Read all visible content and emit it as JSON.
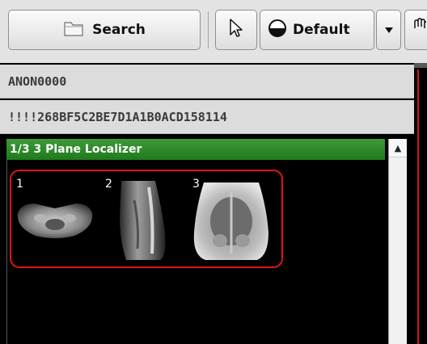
{
  "toolbar": {
    "search_label": "Search",
    "search_icon": "folder-icon",
    "pointer_icon": "cursor-arrow-icon",
    "default_label": "Default",
    "default_icon": "half-circle-icon",
    "dropdown_icon": "chevron-down-icon",
    "hand_icon": "hand-icon"
  },
  "study": {
    "patient_name": "ANON0000",
    "study_uid": "!!!!268BF5C2BE7D1A1B0ACD158114"
  },
  "series": {
    "header": "1/3 3 Plane Localizer",
    "thumbnails": [
      {
        "number": "1"
      },
      {
        "number": "2"
      },
      {
        "number": "3"
      }
    ]
  },
  "scrollbar": {
    "up_arrow": "▲"
  }
}
